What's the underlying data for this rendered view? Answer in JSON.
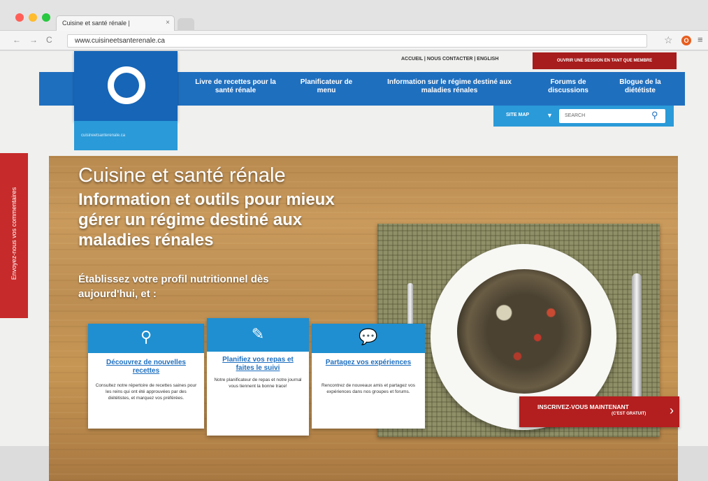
{
  "browser": {
    "tab_title": "Cuisine et santé rénale | ",
    "tab_close": "×",
    "url": "www.cuisineetsanterenale.ca",
    "ext_label": "O"
  },
  "utility": {
    "links": "ACCUEIL | NOUS CONTACTER | ENGLISH",
    "cta": "OUVRIR UNE SESSION EN TANT QUE MEMBRE"
  },
  "nav": {
    "items": [
      {
        "label": "Livre de recettes pour la santé rénale"
      },
      {
        "label": "Planificateur de menu"
      },
      {
        "label": "Information sur le régime destiné aux maladies rénales"
      },
      {
        "label": "Forums de discussions"
      },
      {
        "label": "Blogue de la diététiste"
      }
    ]
  },
  "logo": {
    "sub": "cuisineetsanterenale.ca"
  },
  "search": {
    "sitemap": "SITE MAP",
    "placeholder": "SEARCH"
  },
  "feedback": "Envoyez-nous vos commentaires",
  "hero": {
    "title": "Cuisine et santé rénale",
    "subtitle": "Information et outils pour mieux gérer un régime destiné aux maladies rénales",
    "cta": "Établissez votre profil nutritionnel dès aujourd'hui, et :"
  },
  "cards": [
    {
      "icon": "search-icon",
      "title": "Découvrez de nouvelles recettes",
      "text": "Consultez notre répertoire de recettes saines pour les reins qui ont été approuvées par des diététistes, et marquez vos préférées."
    },
    {
      "icon": "planner-icon",
      "title": "Planifiez vos repas et faites le suivi",
      "text": "Notre planificateur de repas et notre journal vous tiennent la bonne trace!"
    },
    {
      "icon": "chat-icon",
      "title": "Partagez vos expériences",
      "text": "Rencontrez de nouveaux amis et partagez vos expériences dans nos groupes et forums."
    }
  ],
  "signup": {
    "line1": "INSCRIVEZ-VOUS MAINTENANT",
    "line2": "(C'EST GRATUIT)"
  },
  "colors": {
    "nav_blue": "#1f6fbf",
    "accent_blue": "#2a9ad8",
    "cta_red": "#b31e1e"
  }
}
